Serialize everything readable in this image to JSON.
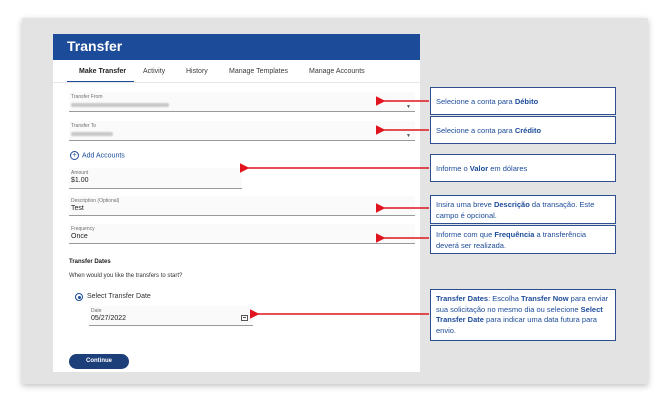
{
  "header": {
    "title": "Transfer"
  },
  "tabs": [
    {
      "label": "Make Transfer"
    },
    {
      "label": "Activity"
    },
    {
      "label": "History"
    },
    {
      "label": "Manage Templates"
    },
    {
      "label": "Manage Accounts"
    }
  ],
  "form": {
    "transfer_from_label": "Transfer From",
    "transfer_to_label": "Transfer To",
    "add_accounts": "Add Accounts",
    "amount_label": "Amount",
    "amount_value": "$1.00",
    "description_label": "Description (Optional)",
    "description_value": "Test",
    "frequency_label": "Frequency",
    "frequency_value": "Once",
    "dates_title": "Transfer Dates",
    "dates_question": "When would you like the transfers to start?",
    "select_date_label": "Select Transfer Date",
    "date_label": "Date",
    "date_value": "05/27/2022",
    "continue_label": "Continue"
  },
  "callouts": {
    "debito": {
      "pre": "Selecione a conta para ",
      "bold": "Débito"
    },
    "credito": {
      "pre": "Selecione a conta para ",
      "bold": "Crédito"
    },
    "valor": {
      "pre": "Informe o ",
      "bold": "Valor",
      "post": " em dólares"
    },
    "descricao": {
      "pre": "Insira uma breve ",
      "bold": "Descrição",
      "post": " da transação. Este campo é opcional."
    },
    "frequencia": {
      "pre": "Informe com que ",
      "bold": "Frequência",
      "post": " a transferência deverá ser realizada."
    },
    "dates": {
      "bold1": "Transfer Dates",
      "t1": ": Escolha ",
      "bold2": "Transfer Now",
      "t2": " para enviar sua solicitação no mesmo dia ou selecione ",
      "bold3": "Select Transfer Date",
      "t3": " para indicar uma data futura para envio."
    }
  },
  "colors": {
    "brand": "#1c4b99",
    "arrow": "#e0141e"
  }
}
